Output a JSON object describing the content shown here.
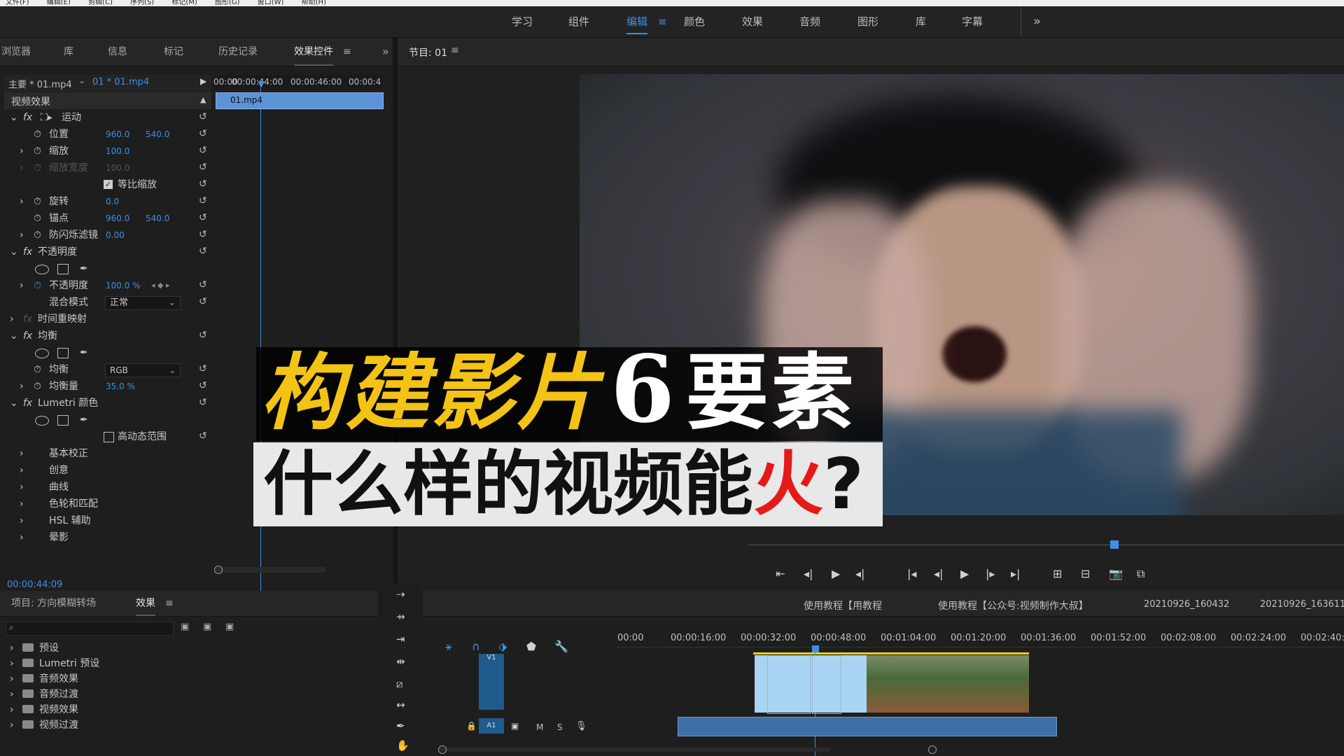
{
  "menu": [
    "文件(F)",
    "编辑(E)",
    "剪辑(C)",
    "序列(S)",
    "标记(M)",
    "图形(G)",
    "窗口(W)",
    "帮助(H)"
  ],
  "workspace_tabs": [
    {
      "label": "学习"
    },
    {
      "label": "组件"
    },
    {
      "label": "编辑",
      "active": true
    },
    {
      "label": "颜色"
    },
    {
      "label": "效果"
    },
    {
      "label": "音频"
    },
    {
      "label": "图形"
    },
    {
      "label": "库"
    },
    {
      "label": "字幕"
    }
  ],
  "workspace_more": "»",
  "left_tabs": [
    "浏览器",
    "库",
    "信息",
    "标记",
    "历史记录",
    "效果控件"
  ],
  "left_more": "»",
  "program_monitor_title": "节目: 01",
  "effect_controls": {
    "master_label": "主要 * 01.mp4",
    "sequence_label": "01 * 01.mp4",
    "ruler_times": [
      "00:00",
      "00:00:44:00",
      "00:00:46:00",
      "00:00:4"
    ],
    "clip_name": "01.mp4",
    "section": "视频效果",
    "motion": "运动",
    "position_label": "位置",
    "position_x": "960.0",
    "position_y": "540.0",
    "scale_label": "缩放",
    "scale_value": "100.0",
    "scale_width_label": "缩放宽度",
    "scale_width_value": "100.0",
    "uniform_scale": "等比缩放",
    "rotation_label": "旋转",
    "rotation_value": "0.0",
    "anchor_label": "锚点",
    "anchor_x": "960.0",
    "anchor_y": "540.0",
    "flicker_label": "防闪烁滤镜",
    "flicker_value": "0.00",
    "opacity_fx": "不透明度",
    "opacity_label": "不透明度",
    "opacity_value": "100.0 %",
    "blend_label": "混合模式",
    "blend_value": "正常",
    "time_remap": "时间重映射",
    "equalize_fx": "均衡",
    "equalize_label": "均衡",
    "equalize_value": "RGB",
    "equalize_amount_label": "均衡量",
    "equalize_amount_value": "35.0 %",
    "lumetri": "Lumetri 颜色",
    "hdr_label": "高动态范围",
    "lumetri_items": [
      "基本校正",
      "创意",
      "曲线",
      "色轮和匹配",
      "HSL 辅助",
      "晕影"
    ],
    "current_time": "00:00:44:09"
  },
  "project_panel": {
    "tab_project": "项目: 方向模糊转场",
    "tab_effects": "效果",
    "items": [
      "预设",
      "Lumetri 预设",
      "音频效果",
      "音频过渡",
      "视频效果",
      "视频过渡"
    ]
  },
  "overlay": {
    "title_yellow": "构建影片",
    "title_number": "6",
    "title_white": "要素",
    "subtitle_main": "什么样的视频能",
    "subtitle_red": "火",
    "subtitle_q": "?"
  },
  "timeline": {
    "seq_tabs": [
      "使用教程【用教程",
      "使用教程【公众号:视频制作大叔】",
      "20210926_160432",
      "20210926_163611"
    ],
    "ruler": [
      "00:00",
      "00:00:16:00",
      "00:00:32:00",
      "00:00:48:00",
      "00:01:04:00",
      "00:01:20:00",
      "00:01:36:00",
      "00:01:52:00",
      "00:02:08:00",
      "00:02:24:00",
      "00:02:40:"
    ],
    "v1": "V1",
    "a1": "A1",
    "m": "M",
    "s": "S"
  },
  "colors": {
    "accent": "#3d8fe3",
    "title_yellow": "#f3c316",
    "subtitle_red": "#e41a1a"
  }
}
